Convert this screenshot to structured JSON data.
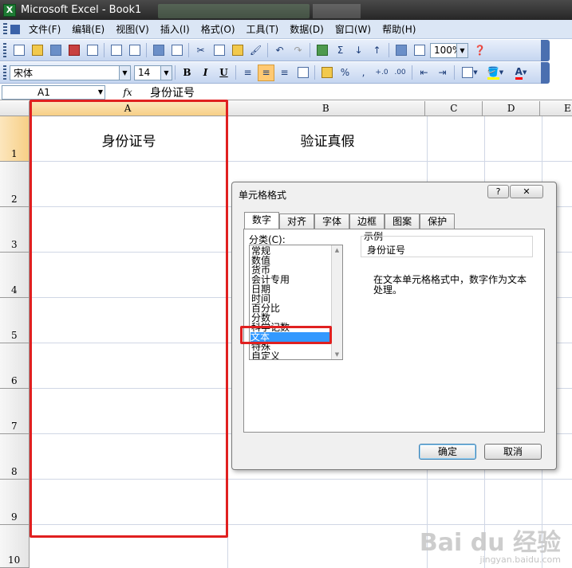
{
  "window": {
    "title": "Microsoft Excel - Book1",
    "icon": "X"
  },
  "menu": [
    "文件(F)",
    "编辑(E)",
    "视图(V)",
    "插入(I)",
    "格式(O)",
    "工具(T)",
    "数据(D)",
    "窗口(W)",
    "帮助(H)"
  ],
  "toolbar": {
    "zoom": "100%"
  },
  "format_toolbar": {
    "font": "宋体",
    "size": "14",
    "bold": "B",
    "italic": "I",
    "underline": "U",
    "percent": "%",
    "comma": ","
  },
  "formula_bar": {
    "name_box": "A1",
    "fx": "fx",
    "content": "身份证号"
  },
  "sheet": {
    "columns": [
      "A",
      "B",
      "C",
      "D",
      "E"
    ],
    "rows": [
      "1",
      "2",
      "3",
      "4",
      "5",
      "6",
      "7",
      "8",
      "9",
      "10"
    ],
    "cells": {
      "A1": "身份证号",
      "B1": "验证真假"
    }
  },
  "dialog": {
    "title": "单元格格式",
    "help": "?",
    "close": "✕",
    "tabs": [
      "数字",
      "对齐",
      "字体",
      "边框",
      "图案",
      "保护"
    ],
    "category_label": "分类(C):",
    "categories": [
      "常规",
      "数值",
      "货币",
      "会计专用",
      "日期",
      "时间",
      "百分比",
      "分数",
      "科学记数",
      "文本",
      "特殊",
      "自定义"
    ],
    "selected_category": "文本",
    "sample_label": "示例",
    "sample_value": "身份证号",
    "description": "在文本单元格格式中，数字作为文本处理。",
    "ok": "确定",
    "cancel": "取消"
  },
  "watermark": {
    "brand": "Bai du 经验",
    "site": "jingyan.baidu.com"
  }
}
